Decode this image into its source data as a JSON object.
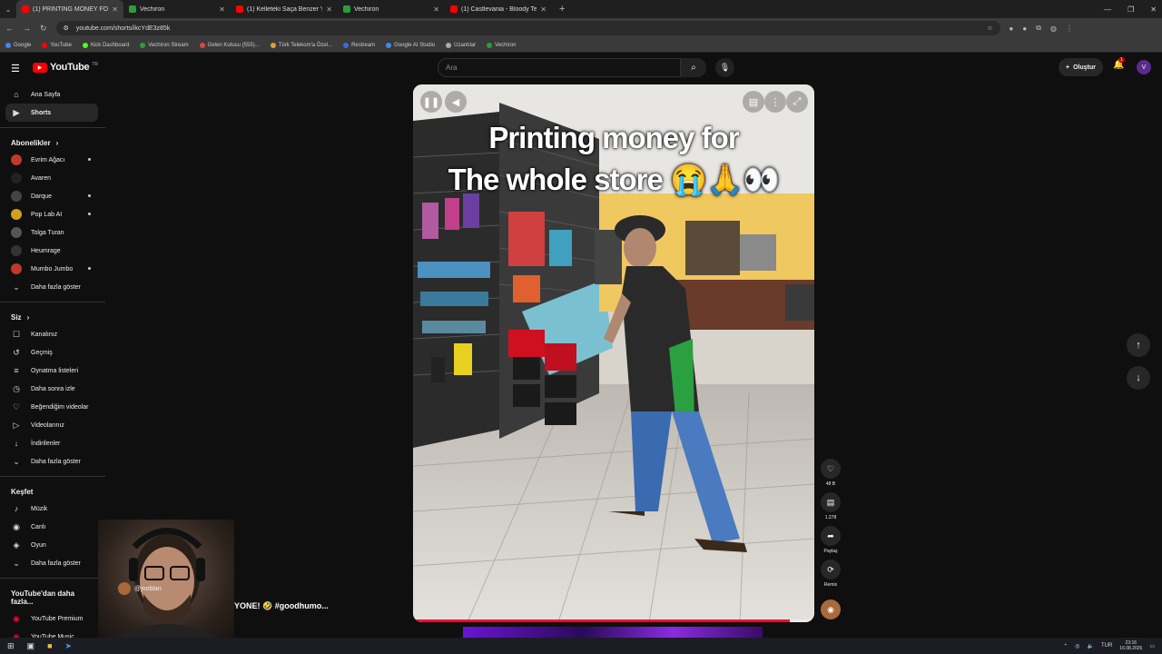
{
  "browser": {
    "tabs": [
      {
        "title": "(1) PRINTING MONEY FOR",
        "color": "#ff0000",
        "active": true
      },
      {
        "title": "Vechiron",
        "color": "#2a9d3a",
        "active": false
      },
      {
        "title": "(1) Kelleteki Saça Benzer Yapısıy",
        "color": "#ff0000",
        "active": false
      },
      {
        "title": "Vechiron",
        "color": "#2a9d3a",
        "active": false
      },
      {
        "title": "(1) Castlevania - Bloody Tears (",
        "color": "#ff0000",
        "active": false
      }
    ],
    "url": "youtube.com/shorts/ikcYdE3z85k",
    "bookmarks": [
      "Google",
      "YouTube",
      "Kick Dashboard",
      "Vechiron Stream",
      "Gelen Kutusu (555)...",
      "Türk Telekom'a Özel...",
      "Restream",
      "Google AI Studio",
      "Uzantılar",
      "Vechiron"
    ]
  },
  "header": {
    "logo": "YouTube",
    "country": "TR",
    "search_placeholder": "Ara",
    "create_label": "Oluştur",
    "notif_count": "1",
    "avatar_letter": "V"
  },
  "sidebar": {
    "main": [
      {
        "label": "Ana Sayfa",
        "icon": "⌂",
        "active": false
      },
      {
        "label": "Shorts",
        "icon": "▶",
        "active": true
      }
    ],
    "subs_header": "Abonelikler",
    "subs": [
      {
        "label": "Evrim Ağacı",
        "color": "#c0392b",
        "dot": true
      },
      {
        "label": "Avaren",
        "color": "#222",
        "dot": false
      },
      {
        "label": "Darque",
        "color": "#444",
        "dot": true
      },
      {
        "label": "Pop Lab AI",
        "color": "#d4a017",
        "dot": true
      },
      {
        "label": "Tolga Turan",
        "color": "#555",
        "dot": false
      },
      {
        "label": "Heumrage",
        "color": "#333",
        "dot": false
      },
      {
        "label": "Mumbo Jumbo",
        "color": "#c0392b",
        "dot": true
      }
    ],
    "subs_more": "Daha fazla göster",
    "you_header": "Siz",
    "you": [
      {
        "label": "Kanalınız",
        "icon": "☐"
      },
      {
        "label": "Geçmiş",
        "icon": "↺"
      },
      {
        "label": "Oynatma listeleri",
        "icon": "≡"
      },
      {
        "label": "Daha sonra izle",
        "icon": "◷"
      },
      {
        "label": "Beğendiğim videolar",
        "icon": "♡"
      },
      {
        "label": "Videolarınız",
        "icon": "▷"
      },
      {
        "label": "İndirilenler",
        "icon": "↓"
      }
    ],
    "you_more": "Daha fazla göster",
    "explore_header": "Keşfet",
    "explore": [
      {
        "label": "Müzik",
        "icon": "♪"
      },
      {
        "label": "Canlı",
        "icon": "◉"
      },
      {
        "label": "Oyun",
        "icon": "◈"
      }
    ],
    "explore_more": "Daha fazla göster",
    "more_header": "YouTube'dan daha fazla...",
    "more": [
      {
        "label": "YouTube Premium"
      },
      {
        "label": "YouTube Music"
      }
    ]
  },
  "video": {
    "caption_line1": "Printing money for",
    "caption_line2": "The whole store 😭🙏👀",
    "progress": 0.94
  },
  "actions": [
    {
      "name": "like",
      "icon": "♡",
      "label": "48 B"
    },
    {
      "name": "comment",
      "icon": "▤",
      "label": "1.278"
    },
    {
      "name": "share",
      "icon": "➦",
      "label": "Paylaş"
    },
    {
      "name": "remix",
      "icon": "⟳",
      "label": "Remix"
    }
  ],
  "overlay": {
    "username": "@jnoblan",
    "tagline": "YONE! 🤣 #goodhumo..."
  },
  "taskbar": {
    "lang": "TUR",
    "time": "23:16",
    "date": "16.08.2026"
  }
}
